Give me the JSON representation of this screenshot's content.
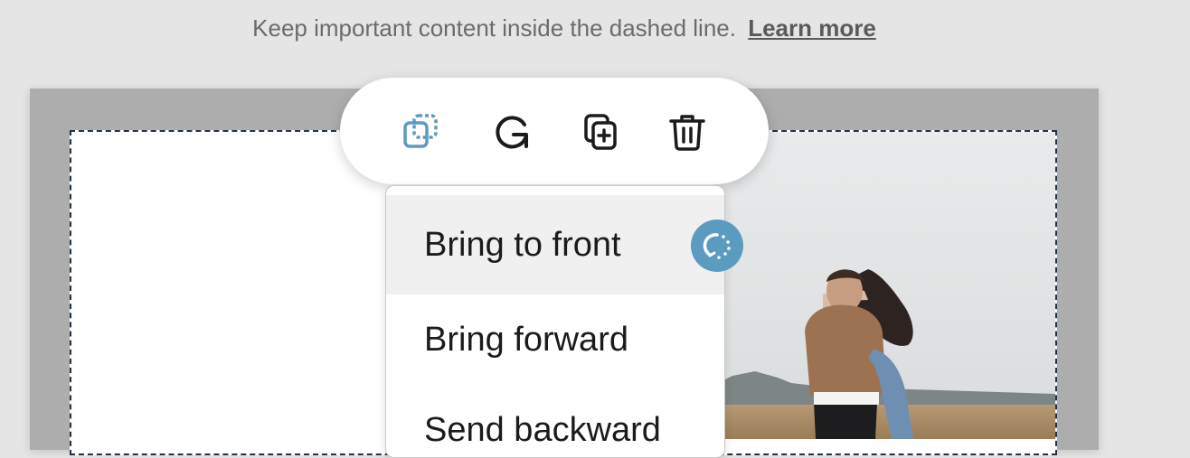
{
  "hint": {
    "text": "Keep important content inside the dashed line.",
    "link_label": "Learn more"
  },
  "toolbar": {
    "buttons": [
      {
        "icon": "arrange-layers-icon",
        "color": "#5b9bc0"
      },
      {
        "icon": "rotate-icon",
        "color": "#1b1b1b"
      },
      {
        "icon": "duplicate-icon",
        "color": "#1b1b1b"
      },
      {
        "icon": "trash-icon",
        "color": "#1b1b1b"
      }
    ]
  },
  "arrange_menu": {
    "items": [
      {
        "label": "Bring to front",
        "active": true
      },
      {
        "label": "Bring forward",
        "active": false
      },
      {
        "label": "Send backward",
        "active": false
      }
    ]
  },
  "colors": {
    "accent": "#5b9bc0",
    "page_background": "#e5e5e5",
    "safe_zone_border": "#24334a"
  }
}
